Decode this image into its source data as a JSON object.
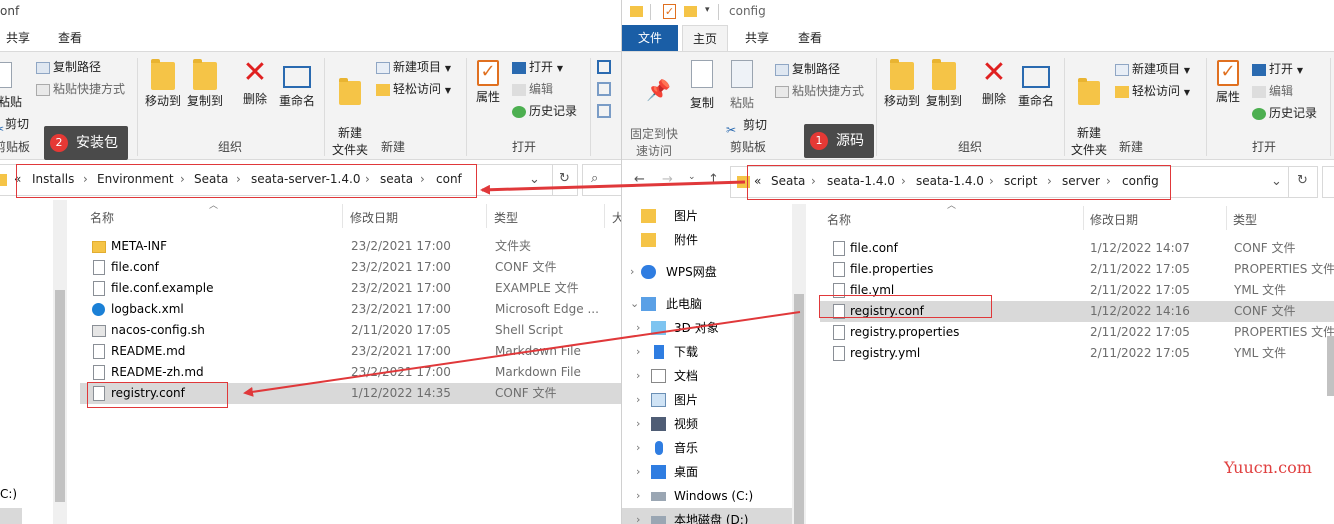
{
  "left": {
    "title": "onf",
    "tabs": {
      "share": "共享",
      "view": "查看"
    },
    "ribbon": {
      "paste": "粘贴",
      "cut": "剪切",
      "clipboard": "剪贴板",
      "copy_path": "复制路径",
      "paste_shortcut": "粘贴快捷方式",
      "move_to": "移动到",
      "copy_to": "复制到",
      "delete": "删除",
      "rename": "重命名",
      "organize": "组织",
      "new_folder": "新建\n文件夹",
      "new_item": "新建项目",
      "easy_access": "轻松访问",
      "new": "新建",
      "properties": "属性",
      "open": "打开",
      "edit": "编辑",
      "history": "历史记录",
      "open_group": "打开"
    },
    "breadcrumb": [
      "«",
      "Installs",
      "Environment",
      "Seata",
      "seata-server-1.4.0",
      "seata",
      "conf"
    ],
    "columns": {
      "name": "名称",
      "date": "修改日期",
      "type": "类型",
      "size": "大"
    },
    "files": [
      {
        "name": "META-INF",
        "date": "23/2/2021 17:00",
        "type": "文件夹",
        "icon": "folder"
      },
      {
        "name": "file.conf",
        "date": "23/2/2021 17:00",
        "type": "CONF 文件",
        "icon": "doc"
      },
      {
        "name": "file.conf.example",
        "date": "23/2/2021 17:00",
        "type": "EXAMPLE 文件",
        "icon": "doc"
      },
      {
        "name": "logback.xml",
        "date": "23/2/2021 17:00",
        "type": "Microsoft Edge ...",
        "icon": "edge-icon"
      },
      {
        "name": "nacos-config.sh",
        "date": "2/11/2020 17:05",
        "type": "Shell Script",
        "icon": "script"
      },
      {
        "name": "README.md",
        "date": "23/2/2021 17:00",
        "type": "Markdown File",
        "icon": "doc"
      },
      {
        "name": "README-zh.md",
        "date": "23/2/2021 17:00",
        "type": "Markdown File",
        "icon": "doc"
      },
      {
        "name": "registry.conf",
        "date": "1/12/2022 14:35",
        "type": "CONF 文件",
        "icon": "doc"
      }
    ],
    "drive": "C:)",
    "callout": {
      "num": "2",
      "label": "安装包"
    }
  },
  "right": {
    "title": "config",
    "tabs": {
      "file": "文件",
      "home": "主页",
      "share": "共享",
      "view": "查看"
    },
    "ribbon": {
      "pin": "固定到快\n速访问",
      "copy": "复制",
      "paste": "粘贴",
      "cut": "剪切",
      "clipboard": "剪贴板",
      "copy_path": "复制路径",
      "paste_shortcut": "粘贴快捷方式",
      "move_to": "移动到",
      "copy_to": "复制到",
      "delete": "删除",
      "rename": "重命名",
      "organize": "组织",
      "new_folder": "新建\n文件夹",
      "new_item": "新建项目",
      "easy_access": "轻松访问",
      "new": "新建",
      "properties": "属性",
      "open": "打开",
      "edit": "编辑",
      "history": "历史记录",
      "open_group": "打开"
    },
    "breadcrumb": [
      "«",
      "Seata",
      "seata-1.4.0",
      "seata-1.4.0",
      "script",
      "server",
      "config"
    ],
    "columns": {
      "name": "名称",
      "date": "修改日期",
      "type": "类型"
    },
    "tree": [
      {
        "label": "图片",
        "icon": "folder",
        "chev": ""
      },
      {
        "label": "附件",
        "icon": "folder",
        "chev": ""
      },
      {
        "label": "WPS网盘",
        "icon": "cloud-icon",
        "chev": "›"
      },
      {
        "label": "此电脑",
        "icon": "pc-icon",
        "chev": "⌄"
      },
      {
        "label": "3D 对象",
        "icon": "cube-icon",
        "chev": "›"
      },
      {
        "label": "下载",
        "icon": "download-icon",
        "chev": "›"
      },
      {
        "label": "文档",
        "icon": "document-icon",
        "chev": "›"
      },
      {
        "label": "图片",
        "icon": "picture-icon",
        "chev": "›"
      },
      {
        "label": "视频",
        "icon": "video-icon",
        "chev": "›"
      },
      {
        "label": "音乐",
        "icon": "music-icon",
        "chev": "›"
      },
      {
        "label": "桌面",
        "icon": "desktop-icon",
        "chev": "›"
      },
      {
        "label": "Windows (C:)",
        "icon": "drive-icon",
        "chev": "›"
      },
      {
        "label": "本地磁盘 (D:)",
        "icon": "drive-icon",
        "chev": "›"
      }
    ],
    "files": [
      {
        "name": "file.conf",
        "date": "1/12/2022 14:07",
        "type": "CONF 文件"
      },
      {
        "name": "file.properties",
        "date": "2/11/2022 17:05",
        "type": "PROPERTIES 文件"
      },
      {
        "name": "file.yml",
        "date": "2/11/2022 17:05",
        "type": "YML 文件"
      },
      {
        "name": "registry.conf",
        "date": "1/12/2022 14:16",
        "type": "CONF 文件"
      },
      {
        "name": "registry.properties",
        "date": "2/11/2022 17:05",
        "type": "PROPERTIES 文件"
      },
      {
        "name": "registry.yml",
        "date": "2/11/2022 17:05",
        "type": "YML 文件"
      }
    ],
    "callout": {
      "num": "1",
      "label": "源码"
    }
  },
  "watermark": "Yuucn.com",
  "colors": {
    "accent": "#1a5ea6",
    "annotation": "#e0383a",
    "callout_bg": "#4a4a4a"
  }
}
